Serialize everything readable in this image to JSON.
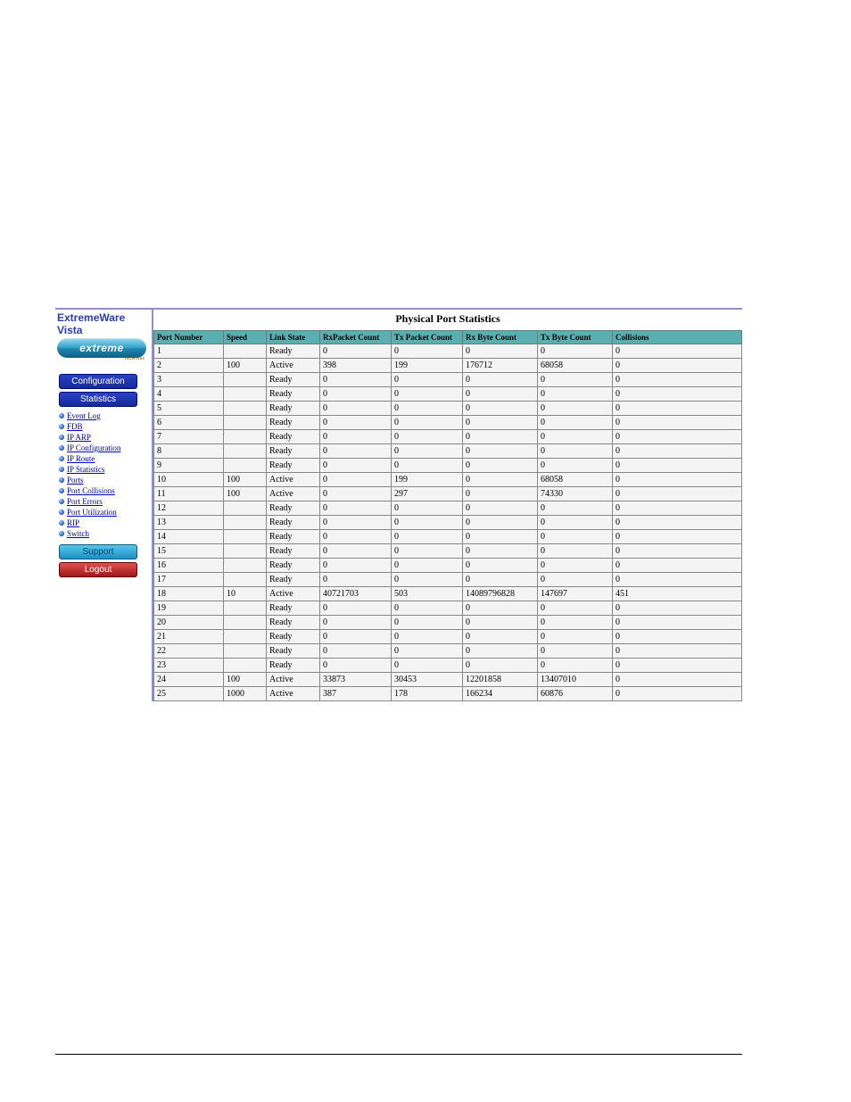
{
  "sidebar": {
    "brand_title": "ExtremeWare Vista",
    "brand_logo": "extreme",
    "brand_sub": "networks",
    "buttons": {
      "config": "Configuration",
      "stats": "Statistics",
      "support": "Support",
      "logout": "Logout"
    },
    "nav": [
      "Event Log",
      "FDB",
      "IP ARP",
      "IP Configuration",
      "IP Route",
      "IP Statistics",
      "Ports",
      "Port Collisions",
      "Port Errors",
      "Port Utilization",
      "RIP",
      "Switch"
    ]
  },
  "main": {
    "title": "Physical Port Statistics",
    "columns": [
      "Port Number",
      "Speed",
      "Link State",
      "RxPacket Count",
      "Tx Packet Count",
      "Rx Byte Count",
      "Tx Byte Count",
      "Collisions"
    ],
    "rows": [
      {
        "port": "1",
        "speed": "",
        "link": "Ready",
        "rxp": "0",
        "txp": "0",
        "rxb": "0",
        "txb": "0",
        "coll": "0"
      },
      {
        "port": "2",
        "speed": "100",
        "link": "Active",
        "rxp": "398",
        "txp": "199",
        "rxb": "176712",
        "txb": "68058",
        "coll": "0"
      },
      {
        "port": "3",
        "speed": "",
        "link": "Ready",
        "rxp": "0",
        "txp": "0",
        "rxb": "0",
        "txb": "0",
        "coll": "0"
      },
      {
        "port": "4",
        "speed": "",
        "link": "Ready",
        "rxp": "0",
        "txp": "0",
        "rxb": "0",
        "txb": "0",
        "coll": "0"
      },
      {
        "port": "5",
        "speed": "",
        "link": "Ready",
        "rxp": "0",
        "txp": "0",
        "rxb": "0",
        "txb": "0",
        "coll": "0"
      },
      {
        "port": "6",
        "speed": "",
        "link": "Ready",
        "rxp": "0",
        "txp": "0",
        "rxb": "0",
        "txb": "0",
        "coll": "0"
      },
      {
        "port": "7",
        "speed": "",
        "link": "Ready",
        "rxp": "0",
        "txp": "0",
        "rxb": "0",
        "txb": "0",
        "coll": "0"
      },
      {
        "port": "8",
        "speed": "",
        "link": "Ready",
        "rxp": "0",
        "txp": "0",
        "rxb": "0",
        "txb": "0",
        "coll": "0"
      },
      {
        "port": "9",
        "speed": "",
        "link": "Ready",
        "rxp": "0",
        "txp": "0",
        "rxb": "0",
        "txb": "0",
        "coll": "0"
      },
      {
        "port": "10",
        "speed": "100",
        "link": "Active",
        "rxp": "0",
        "txp": "199",
        "rxb": "0",
        "txb": "68058",
        "coll": "0"
      },
      {
        "port": "11",
        "speed": "100",
        "link": "Active",
        "rxp": "0",
        "txp": "297",
        "rxb": "0",
        "txb": "74330",
        "coll": "0"
      },
      {
        "port": "12",
        "speed": "",
        "link": "Ready",
        "rxp": "0",
        "txp": "0",
        "rxb": "0",
        "txb": "0",
        "coll": "0"
      },
      {
        "port": "13",
        "speed": "",
        "link": "Ready",
        "rxp": "0",
        "txp": "0",
        "rxb": "0",
        "txb": "0",
        "coll": "0"
      },
      {
        "port": "14",
        "speed": "",
        "link": "Ready",
        "rxp": "0",
        "txp": "0",
        "rxb": "0",
        "txb": "0",
        "coll": "0"
      },
      {
        "port": "15",
        "speed": "",
        "link": "Ready",
        "rxp": "0",
        "txp": "0",
        "rxb": "0",
        "txb": "0",
        "coll": "0"
      },
      {
        "port": "16",
        "speed": "",
        "link": "Ready",
        "rxp": "0",
        "txp": "0",
        "rxb": "0",
        "txb": "0",
        "coll": "0"
      },
      {
        "port": "17",
        "speed": "",
        "link": "Ready",
        "rxp": "0",
        "txp": "0",
        "rxb": "0",
        "txb": "0",
        "coll": "0"
      },
      {
        "port": "18",
        "speed": "10",
        "link": "Active",
        "rxp": "40721703",
        "txp": "503",
        "rxb": "14089796828",
        "txb": "147697",
        "coll": "451"
      },
      {
        "port": "19",
        "speed": "",
        "link": "Ready",
        "rxp": "0",
        "txp": "0",
        "rxb": "0",
        "txb": "0",
        "coll": "0"
      },
      {
        "port": "20",
        "speed": "",
        "link": "Ready",
        "rxp": "0",
        "txp": "0",
        "rxb": "0",
        "txb": "0",
        "coll": "0"
      },
      {
        "port": "21",
        "speed": "",
        "link": "Ready",
        "rxp": "0",
        "txp": "0",
        "rxb": "0",
        "txb": "0",
        "coll": "0"
      },
      {
        "port": "22",
        "speed": "",
        "link": "Ready",
        "rxp": "0",
        "txp": "0",
        "rxb": "0",
        "txb": "0",
        "coll": "0"
      },
      {
        "port": "23",
        "speed": "",
        "link": "Ready",
        "rxp": "0",
        "txp": "0",
        "rxb": "0",
        "txb": "0",
        "coll": "0"
      },
      {
        "port": "24",
        "speed": "100",
        "link": "Active",
        "rxp": "33873",
        "txp": "30453",
        "rxb": "12201858",
        "txb": "13407010",
        "coll": "0"
      },
      {
        "port": "25",
        "speed": "1000",
        "link": "Active",
        "rxp": "387",
        "txp": "178",
        "rxb": "166234",
        "txb": "60876",
        "coll": "0"
      }
    ]
  }
}
